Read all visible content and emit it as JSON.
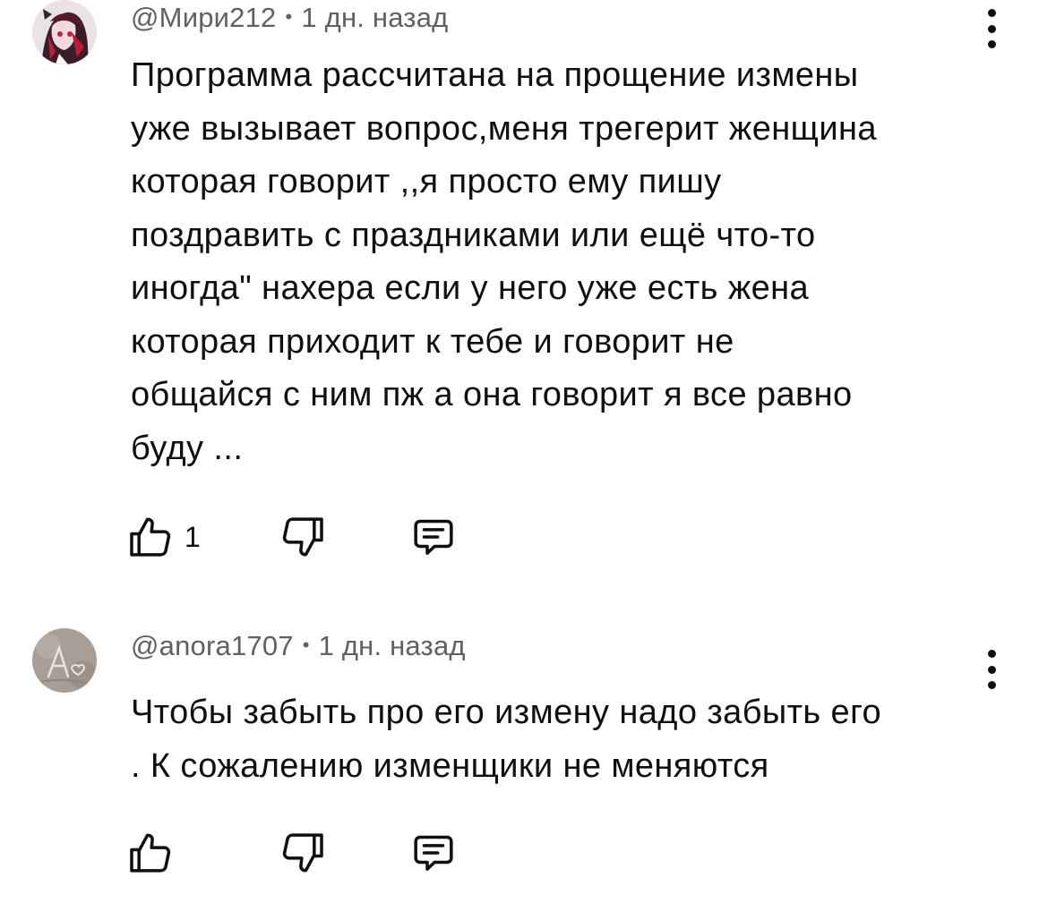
{
  "comments": [
    {
      "author": "@Мири212",
      "time": "1 дн. назад",
      "text": "Программа рассчитана на прощение измены\nуже вызывает вопрос,меня трегерит женщина\nкоторая говорит ,,я просто ему пишу\nпоздравить с праздниками или ещё что-то\nиногда\" нахера если у него уже есть жена\nкоторая приходит к тебе и говорит не\nобщайся с ним пж а она говорит я все равно\nбуду ...",
      "likes": "1",
      "avatar_icon": "anime-girl-avatar"
    },
    {
      "author": "@anora1707",
      "time": "1 дн. назад",
      "text": "Чтобы забыть про его измену надо забыть его\n. К сожалению изменщики не меняются",
      "likes": "",
      "avatar_icon": "sand-drawing-avatar"
    }
  ],
  "separator": "•",
  "icons": {
    "like": "thumbs-up-icon",
    "dislike": "thumbs-down-icon",
    "reply": "reply-comment-icon",
    "menu": "more-vert-icon"
  },
  "colors": {
    "text": "#0f0f0f",
    "meta": "#606060",
    "background": "#ffffff"
  }
}
